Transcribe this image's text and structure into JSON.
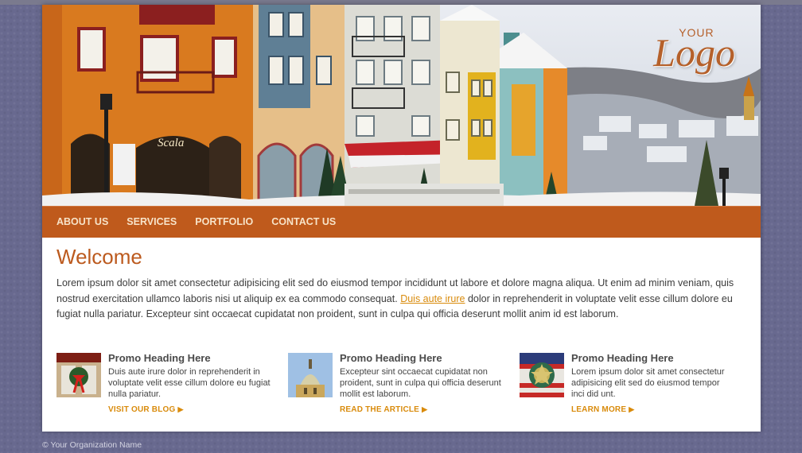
{
  "logo": {
    "small": "YOUR",
    "big": "Logo"
  },
  "nav": {
    "items": [
      "ABOUT US",
      "SERVICES",
      "PORTFOLIO",
      "CONTACT US"
    ]
  },
  "welcome": {
    "heading": "Welcome",
    "text_before": "Lorem ipsum dolor sit amet consectetur adipisicing elit sed do eiusmod tempor incididunt ut labore et dolore magna aliqua. Ut enim ad minim veniam, quis nostrud exercitation ullamco laboris nisi ut aliquip ex ea commodo consequat. ",
    "link": "Duis aute irure",
    "text_after": " dolor in reprehenderit in voluptate velit esse cillum dolore eu fugiat nulla pariatur. Excepteur sint occaecat cupidatat non proident, sunt in culpa qui officia deserunt mollit anim id est laborum."
  },
  "hero": {
    "shop_sign": "Scala"
  },
  "promos": [
    {
      "heading": "Promo Heading Here",
      "text": "Duis aute irure dolor in reprehenderit in voluptate velit esse cillum dolore eu fugiat nulla pariatur.",
      "link": "VISIT OUR BLOG",
      "icon": "christmas-wreath-image"
    },
    {
      "heading": "Promo Heading Here",
      "text": "Excepteur sint occaecat cupidatat non proident, sunt in culpa qui officia deserunt mollit est laborum.",
      "link": "READ THE ARTICLE",
      "icon": "church-dome-image"
    },
    {
      "heading": "Promo Heading Here",
      "text": "Lorem ipsum dolor sit amet consectetur adipisicing elit sed do eiusmod tempor inci did unt.",
      "link": "LEARN MORE",
      "icon": "ornament-badge-image"
    }
  ],
  "footer": {
    "text": "© Your Organization Name"
  },
  "colors": {
    "accent": "#bf5a1c",
    "link": "#d98b0c",
    "background": "#68698f"
  }
}
